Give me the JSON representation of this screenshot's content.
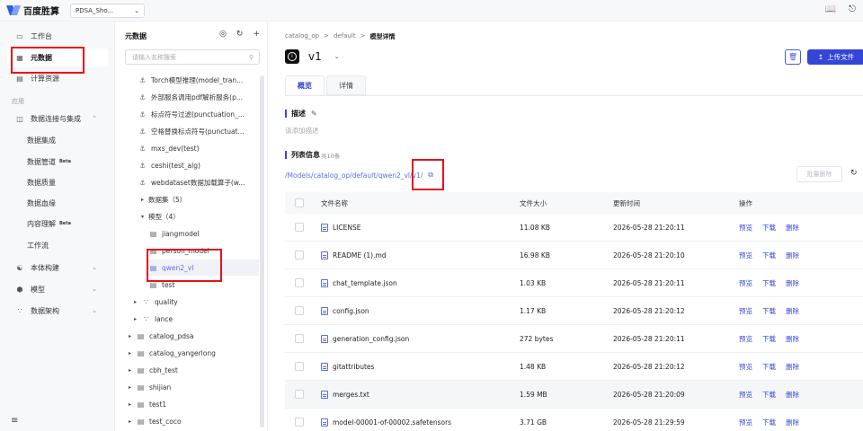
{
  "topbar": {
    "brand": "百度胜算",
    "workspace": "PDSA_Sho...",
    "workspace_chevron": "⌄",
    "icons": [
      "book-icon",
      "export-icon"
    ]
  },
  "nav": {
    "items": [
      {
        "label": "工作台",
        "icon": "folder-icon"
      },
      {
        "label": "元数据",
        "icon": "grid-icon"
      },
      {
        "label": "计算资源",
        "icon": "server-icon"
      }
    ],
    "section": "应用",
    "groups": [
      {
        "label": "数据连接与集成",
        "icon": "database-icon",
        "chevron": "⌃"
      },
      {
        "label": "数据集成"
      },
      {
        "label": "数据管道",
        "badge": "Beta"
      },
      {
        "label": "数据质量"
      },
      {
        "label": "数据血缘"
      },
      {
        "label": "内容理解",
        "badge": "Beta"
      },
      {
        "label": "工作流"
      },
      {
        "label": "本体构建",
        "icon": "ontology-icon",
        "chevron": "⌄"
      },
      {
        "label": "模型",
        "icon": "cube-icon",
        "chevron": "⌄"
      },
      {
        "label": "数据架构",
        "icon": "architecture-icon",
        "chevron": "⌄"
      }
    ],
    "bottom_icon": "menu-icon"
  },
  "tree": {
    "title": "元数据",
    "search_placeholder": "请输入名称搜索",
    "nodes": [
      {
        "label": "Torch模型推理(model_tran...",
        "type": "operator"
      },
      {
        "label": "外部服务调用pdf解析服务(p...",
        "type": "operator"
      },
      {
        "label": "标点符号过滤(punctuation_...",
        "type": "operator"
      },
      {
        "label": "空格替换标点符号(punctuat...",
        "type": "operator"
      },
      {
        "label": "mxs_dev(test)",
        "type": "operator"
      },
      {
        "label": "ceshi(test_alg)",
        "type": "operator"
      },
      {
        "label": "webdataset数据加载算子(w...",
        "type": "operator"
      },
      {
        "label": "数据集（5）",
        "type": "group",
        "tri": "▸"
      },
      {
        "label": "模型（4）",
        "type": "group",
        "tri": "▾"
      },
      {
        "label": "jiangmodel",
        "type": "model"
      },
      {
        "label": "person_model",
        "type": "model"
      },
      {
        "label": "qwen2_vl",
        "type": "model",
        "selected": true
      },
      {
        "label": "test",
        "type": "model"
      },
      {
        "label": "quality",
        "type": "schema",
        "tri": "▸"
      },
      {
        "label": "lance",
        "type": "schema",
        "tri": "▸"
      },
      {
        "label": "catalog_pdsa",
        "type": "catalog",
        "tri": "▸"
      },
      {
        "label": "catalog_yangerlong",
        "type": "catalog",
        "tri": "▸"
      },
      {
        "label": "cbh_test",
        "type": "catalog",
        "tri": "▸"
      },
      {
        "label": "shijian",
        "type": "catalog",
        "tri": "▸"
      },
      {
        "label": "test1",
        "type": "catalog",
        "tri": "▸"
      },
      {
        "label": "test_coco",
        "type": "catalog",
        "tri": "▸"
      }
    ]
  },
  "main": {
    "breadcrumb": [
      "catalog_op",
      "default",
      "模型详情"
    ],
    "breadcrumb_sep": ">",
    "model_name": "v1",
    "model_chevron": "⌄",
    "upload_label": "上传文件",
    "tabs": [
      "概览",
      "详情"
    ],
    "desc_title": "描述",
    "desc_placeholder": "请添加描述",
    "list_title": "列表信息",
    "list_count": "共10条",
    "path": "/Models/catalog_op/default/qwen2_vl/v1/",
    "batch_delete": "批量删除",
    "columns": [
      "文件名称",
      "文件大小",
      "更新时间",
      "操作"
    ],
    "ops": [
      "预览",
      "下载",
      "删除"
    ],
    "rows": [
      {
        "name": "LICENSE",
        "size": "11.08 KB",
        "time": "2026-05-28 21:20:11"
      },
      {
        "name": "README (1).md",
        "size": "16.98 KB",
        "time": "2026-05-28 21:20:10"
      },
      {
        "name": "chat_template.json",
        "size": "1.03 KB",
        "time": "2026-05-28 21:20:11"
      },
      {
        "name": "config.json",
        "size": "1.17 KB",
        "time": "2026-05-28 21:20:12"
      },
      {
        "name": "generation_config.json",
        "size": "272 bytes",
        "time": "2026-05-28 21:20:11"
      },
      {
        "name": "gitattributes",
        "size": "1.48 KB",
        "time": "2026-05-28 21:20:12"
      },
      {
        "name": "merges.txt",
        "size": "1.59 MB",
        "time": "2026-05-28 21:20:09"
      },
      {
        "name": "model-00001-of-00002.safetensors",
        "size": "3.71 GB",
        "time": "2026-05-28 21:29:59"
      }
    ]
  },
  "colors": {
    "accent": "#3346d8",
    "link": "#5b6ee1",
    "highlight": "#e8101a"
  }
}
